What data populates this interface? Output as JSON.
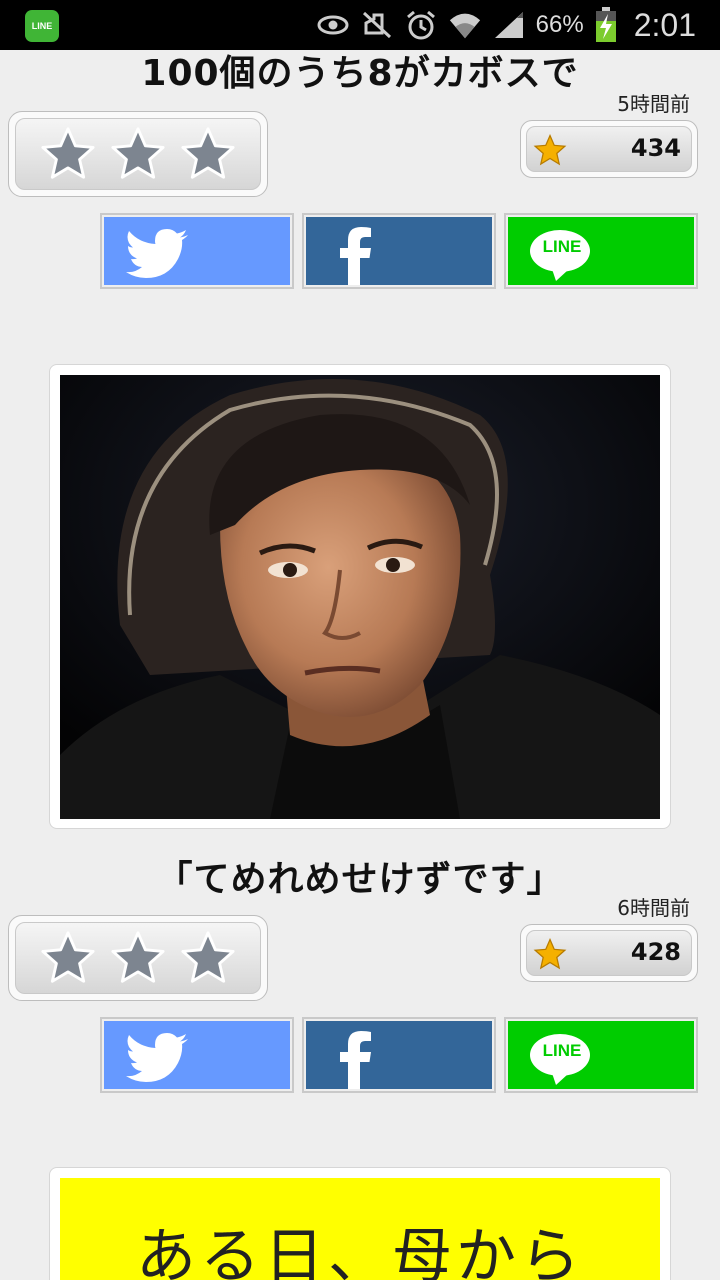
{
  "status_bar": {
    "notification_app": "LINE",
    "icons": [
      "eye-icon",
      "mute-icon",
      "alarm-icon",
      "wifi-icon",
      "signal-icon"
    ],
    "battery": "66%",
    "time": "2:01"
  },
  "posts": [
    {
      "title": "100個のうち8がカボスで",
      "time": "5時間前",
      "rating_stars": 3,
      "count": "434",
      "share": {
        "twitter": "twitter-icon",
        "facebook": "facebook-icon",
        "line": "LINE"
      }
    },
    {
      "title": "「てめれめせけずです」",
      "time": "6時間前",
      "rating_stars": 3,
      "count": "428",
      "share": {
        "twitter": "twitter-icon",
        "facebook": "facebook-icon",
        "line": "LINE"
      }
    }
  ],
  "next_post_image_text": "ある日、母から",
  "colors": {
    "twitter": "#6699ff",
    "facebook": "#336699",
    "line": "#00cc00",
    "star_gray": "#7d8590",
    "star_gold": "#f5b000"
  }
}
